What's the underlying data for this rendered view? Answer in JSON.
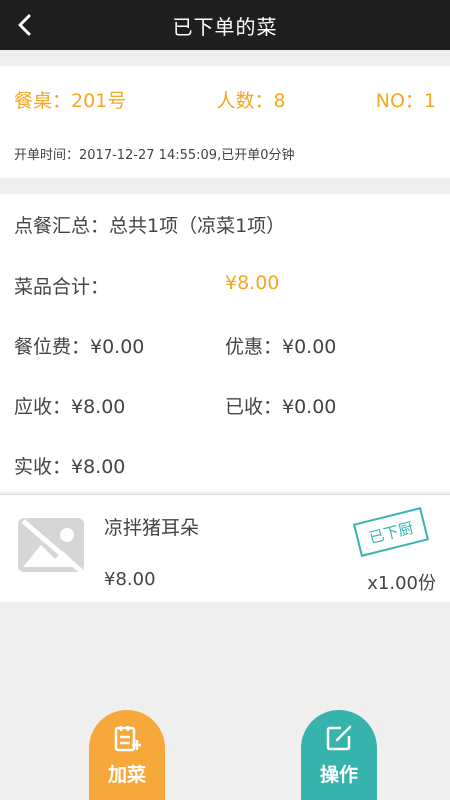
{
  "header": {
    "title": "已下单的菜",
    "back_icon": "back-arrow-icon"
  },
  "table_info": {
    "table": "餐桌：201号",
    "people": "人数：8",
    "number": "NO：1",
    "open_time": "开单时间：2017-12-27 14:55:09,已开单0分钟"
  },
  "summary": {
    "overview": "点餐汇总：总共1项（凉菜1项）",
    "dish_total_label": "菜品合计：",
    "dish_total_value": "¥8.00",
    "seat_fee": "餐位费：¥0.00",
    "discount": "优惠：¥0.00",
    "receivable": "应收：¥8.00",
    "received": "已收：¥0.00",
    "actual": "实收：¥8.00"
  },
  "items": [
    {
      "name": "凉拌猪耳朵",
      "price": "¥8.00",
      "quantity": "x1.00份",
      "status": "已下厨"
    }
  ],
  "actions": {
    "add_label": "加菜",
    "operate_label": "操作"
  },
  "colors": {
    "accent_orange": "#f6a83b",
    "accent_teal": "#36b3ad",
    "topbar": "#1f1f1f"
  }
}
